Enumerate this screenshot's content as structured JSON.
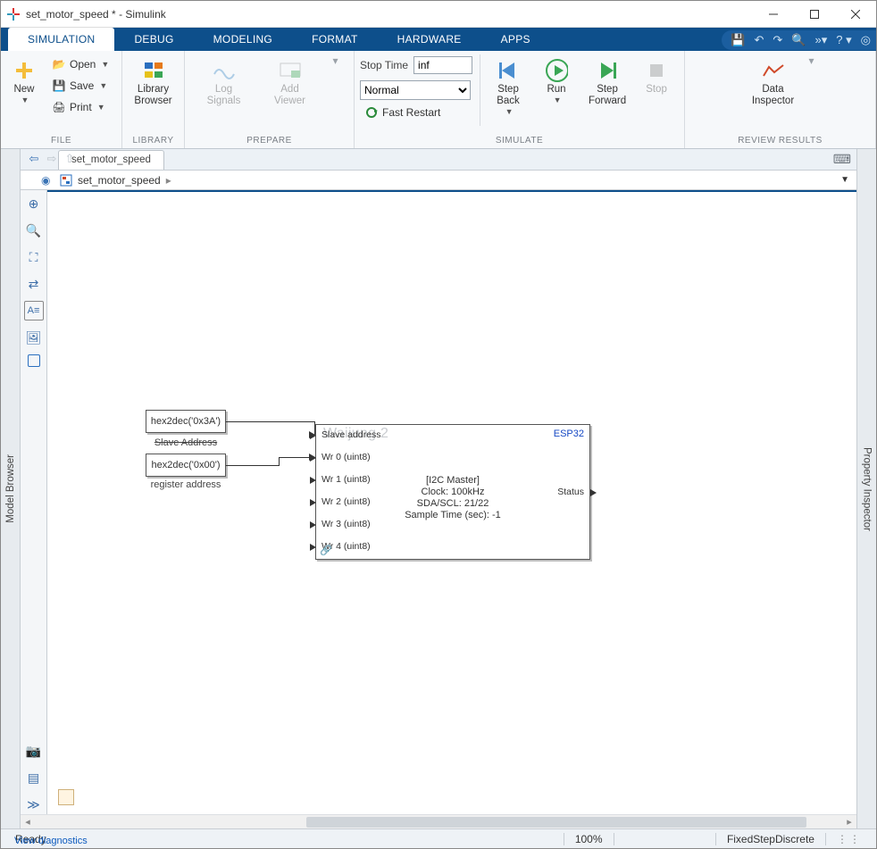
{
  "window": {
    "title": "set_motor_speed * - Simulink"
  },
  "tabs": [
    "SIMULATION",
    "DEBUG",
    "MODELING",
    "FORMAT",
    "HARDWARE",
    "APPS"
  ],
  "activeTab": 0,
  "ribbon": {
    "file": {
      "new": "New",
      "open": "Open",
      "save": "Save",
      "print": "Print",
      "group": "FILE"
    },
    "library": {
      "btn": "Library\nBrowser",
      "group": "LIBRARY"
    },
    "prepare": {
      "log": "Log\nSignals",
      "add": "Add\nViewer",
      "group": "PREPARE"
    },
    "sim": {
      "stoptime_label": "Stop Time",
      "stoptime_value": "inf",
      "mode": "Normal",
      "fast": "Fast Restart",
      "stepback": "Step\nBack",
      "run": "Run",
      "stepfwd": "Step\nForward",
      "stop": "Stop",
      "group": "SIMULATE"
    },
    "review": {
      "data": "Data\nInspector",
      "group": "REVIEW RESULTS"
    }
  },
  "model_tab": "set_motor_speed",
  "crumb": "set_motor_speed",
  "left_panel": "Model Browser",
  "right_panel": "Property Inspector",
  "diagram": {
    "const1": {
      "text": "hex2dec('0x3A')",
      "label": "Slave Address"
    },
    "const2": {
      "text": "hex2dec('0x00')",
      "label": "register address"
    },
    "mainblock": {
      "watermark": "Waijung 2",
      "brand": "ESP32",
      "center": [
        "[I2C Master]",
        "Clock: 100kHz",
        "SDA/SCL: 21/22",
        "Sample Time (sec): -1"
      ],
      "ports_in": [
        "Slave address",
        "Wr 0 (uint8)",
        "Wr 1 (uint8)",
        "Wr 2 (uint8)",
        "Wr 3 (uint8)",
        "Wr 4 (uint8)"
      ],
      "port_out": "Status"
    }
  },
  "status": {
    "ready": "Ready",
    "diag": "View diagnostics",
    "zoom": "100%",
    "solver": "FixedStepDiscrete"
  }
}
